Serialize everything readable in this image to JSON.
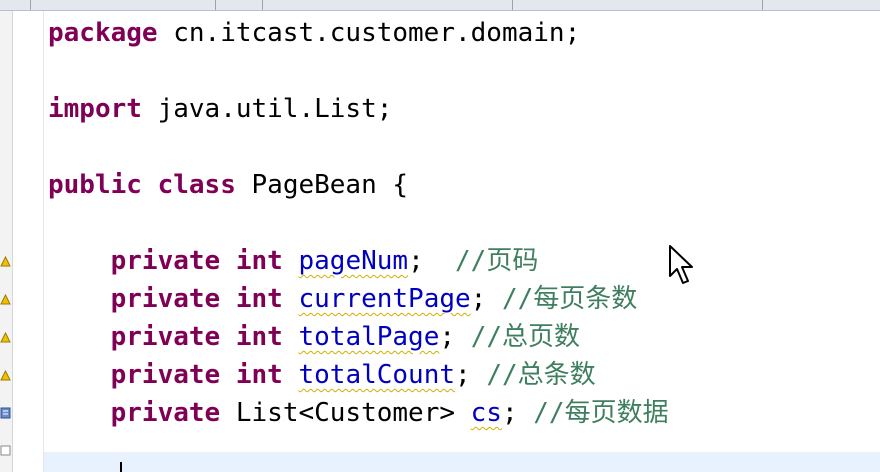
{
  "editor": {
    "lines": [
      {
        "id": "package",
        "parts": [
          {
            "t": "package",
            "k": "kw"
          },
          {
            "t": " cn.itcast.customer.domain;",
            "k": "plain"
          }
        ]
      },
      {
        "id": "blank1",
        "parts": []
      },
      {
        "id": "import",
        "parts": [
          {
            "t": "import",
            "k": "kw"
          },
          {
            "t": " java.util.List;",
            "k": "plain"
          }
        ]
      },
      {
        "id": "blank2",
        "parts": []
      },
      {
        "id": "class-decl",
        "parts": [
          {
            "t": "public",
            "k": "kw"
          },
          {
            "t": " ",
            "k": "plain"
          },
          {
            "t": "class",
            "k": "kw"
          },
          {
            "t": " PageBean {",
            "k": "plain"
          }
        ]
      },
      {
        "id": "blank3",
        "parts": []
      },
      {
        "id": "field-pageNum",
        "parts": [
          {
            "t": "    ",
            "k": "plain"
          },
          {
            "t": "private",
            "k": "kw"
          },
          {
            "t": " ",
            "k": "plain"
          },
          {
            "t": "int",
            "k": "kw"
          },
          {
            "t": " ",
            "k": "plain"
          },
          {
            "t": "pageNum",
            "k": "field"
          },
          {
            "t": ";  ",
            "k": "plain"
          },
          {
            "t": "//页码",
            "k": "cmt"
          }
        ]
      },
      {
        "id": "field-currentPage",
        "parts": [
          {
            "t": "    ",
            "k": "plain"
          },
          {
            "t": "private",
            "k": "kw"
          },
          {
            "t": " ",
            "k": "plain"
          },
          {
            "t": "int",
            "k": "kw"
          },
          {
            "t": " ",
            "k": "plain"
          },
          {
            "t": "currentPage",
            "k": "field"
          },
          {
            "t": "; ",
            "k": "plain"
          },
          {
            "t": "//每页条数",
            "k": "cmt"
          }
        ]
      },
      {
        "id": "field-totalPage",
        "parts": [
          {
            "t": "    ",
            "k": "plain"
          },
          {
            "t": "private",
            "k": "kw"
          },
          {
            "t": " ",
            "k": "plain"
          },
          {
            "t": "int",
            "k": "kw"
          },
          {
            "t": " ",
            "k": "plain"
          },
          {
            "t": "totalPage",
            "k": "field"
          },
          {
            "t": "; ",
            "k": "plain"
          },
          {
            "t": "//总页数",
            "k": "cmt"
          }
        ]
      },
      {
        "id": "field-totalCount",
        "parts": [
          {
            "t": "    ",
            "k": "plain"
          },
          {
            "t": "private",
            "k": "kw"
          },
          {
            "t": " ",
            "k": "plain"
          },
          {
            "t": "int",
            "k": "kw"
          },
          {
            "t": " ",
            "k": "plain"
          },
          {
            "t": "totalCount",
            "k": "field"
          },
          {
            "t": "; ",
            "k": "plain"
          },
          {
            "t": "//总条数",
            "k": "cmt"
          }
        ]
      },
      {
        "id": "field-cs",
        "parts": [
          {
            "t": "    ",
            "k": "plain"
          },
          {
            "t": "private",
            "k": "kw"
          },
          {
            "t": " List<Customer> ",
            "k": "plain"
          },
          {
            "t": "cs",
            "k": "field"
          },
          {
            "t": "; ",
            "k": "plain"
          },
          {
            "t": "//每页数据",
            "k": "cmt"
          }
        ]
      }
    ]
  },
  "colors": {
    "keyword": "#7f0055",
    "field": "#0000c0",
    "comment": "#3f7f5f",
    "warning_marker": "#e8a000"
  },
  "gutter": {
    "markers": [
      "warning-icon",
      "warning-icon",
      "warning-icon",
      "warning-icon",
      "warning-icon"
    ]
  }
}
